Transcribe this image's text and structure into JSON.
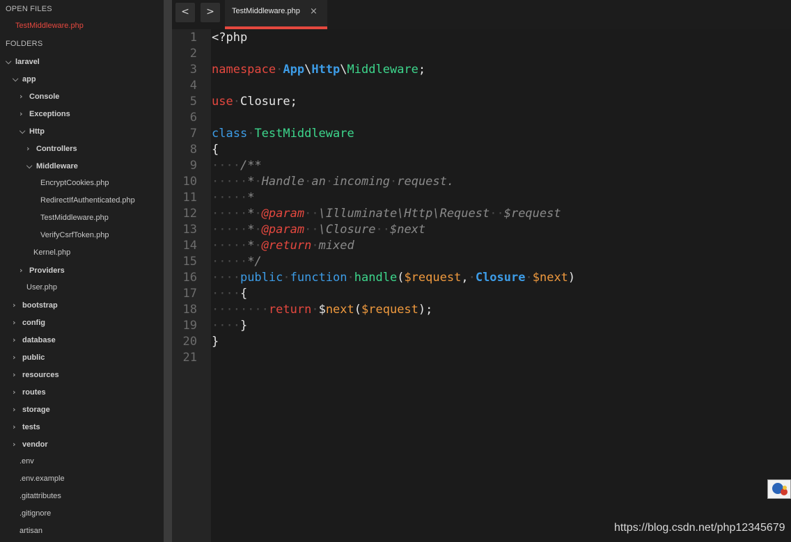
{
  "sidebar": {
    "open_files_title": "OPEN FILES",
    "open_file": "TestMiddleware.php",
    "folders_title": "FOLDERS",
    "tree": [
      {
        "label": "laravel",
        "type": "folder",
        "expanded": true,
        "depth": 0
      },
      {
        "label": "app",
        "type": "folder",
        "expanded": true,
        "depth": 1
      },
      {
        "label": "Console",
        "type": "folder",
        "expanded": false,
        "depth": 2
      },
      {
        "label": "Exceptions",
        "type": "folder",
        "expanded": false,
        "depth": 2
      },
      {
        "label": "Http",
        "type": "folder",
        "expanded": true,
        "depth": 2
      },
      {
        "label": "Controllers",
        "type": "folder",
        "expanded": false,
        "depth": 3
      },
      {
        "label": "Middleware",
        "type": "folder",
        "expanded": true,
        "depth": 3
      },
      {
        "label": "EncryptCookies.php",
        "type": "file",
        "depth": 4
      },
      {
        "label": "RedirectIfAuthenticated.php",
        "type": "file",
        "depth": 4
      },
      {
        "label": "TestMiddleware.php",
        "type": "file",
        "depth": 4,
        "active": true
      },
      {
        "label": "VerifyCsrfToken.php",
        "type": "file",
        "depth": 4
      },
      {
        "label": "Kernel.php",
        "type": "file",
        "depth": 3
      },
      {
        "label": "Providers",
        "type": "folder",
        "expanded": false,
        "depth": 2
      },
      {
        "label": "User.php",
        "type": "file",
        "depth": 2
      },
      {
        "label": "bootstrap",
        "type": "folder",
        "expanded": false,
        "depth": 1
      },
      {
        "label": "config",
        "type": "folder",
        "expanded": false,
        "depth": 1
      },
      {
        "label": "database",
        "type": "folder",
        "expanded": false,
        "depth": 1
      },
      {
        "label": "public",
        "type": "folder",
        "expanded": false,
        "depth": 1
      },
      {
        "label": "resources",
        "type": "folder",
        "expanded": false,
        "depth": 1
      },
      {
        "label": "routes",
        "type": "folder",
        "expanded": false,
        "depth": 1
      },
      {
        "label": "storage",
        "type": "folder",
        "expanded": false,
        "depth": 1
      },
      {
        "label": "tests",
        "type": "folder",
        "expanded": false,
        "depth": 1
      },
      {
        "label": "vendor",
        "type": "folder",
        "expanded": false,
        "depth": 1
      },
      {
        "label": ".env",
        "type": "file",
        "depth": 1
      },
      {
        "label": ".env.example",
        "type": "file",
        "depth": 1
      },
      {
        "label": ".gitattributes",
        "type": "file",
        "depth": 1
      },
      {
        "label": ".gitignore",
        "type": "file",
        "depth": 1
      },
      {
        "label": "artisan",
        "type": "file",
        "depth": 1
      }
    ]
  },
  "tabs": {
    "back_glyph": "<",
    "forward_glyph": ">",
    "active_tab": "TestMiddleware.php",
    "close_glyph": "×"
  },
  "editor": {
    "lines": [
      [
        [
          "t",
          "<?php"
        ]
      ],
      [],
      [
        [
          "k",
          "namespace"
        ],
        [
          "w",
          "·"
        ],
        [
          "n",
          "App"
        ],
        [
          "t",
          "\\"
        ],
        [
          "n",
          "Http"
        ],
        [
          "t",
          "\\"
        ],
        [
          "c",
          "Middleware"
        ],
        [
          "t",
          ";"
        ]
      ],
      [],
      [
        [
          "k",
          "use"
        ],
        [
          "w",
          "·"
        ],
        [
          "t",
          "Closure;"
        ]
      ],
      [],
      [
        [
          "b",
          "class"
        ],
        [
          "w",
          "·"
        ],
        [
          "c",
          "TestMiddleware"
        ]
      ],
      [
        [
          "t",
          "{"
        ]
      ],
      [
        [
          "w",
          "····"
        ],
        [
          "m",
          "/**"
        ]
      ],
      [
        [
          "w",
          "·····"
        ],
        [
          "m",
          "*"
        ],
        [
          "w",
          "·"
        ],
        [
          "m",
          "Handle"
        ],
        [
          "w",
          "·"
        ],
        [
          "m",
          "an"
        ],
        [
          "w",
          "·"
        ],
        [
          "m",
          "incoming"
        ],
        [
          "w",
          "·"
        ],
        [
          "m",
          "request."
        ]
      ],
      [
        [
          "w",
          "·····"
        ],
        [
          "m",
          "*"
        ]
      ],
      [
        [
          "w",
          "·····"
        ],
        [
          "m",
          "*"
        ],
        [
          "w",
          "·"
        ],
        [
          "g",
          "@param"
        ],
        [
          "w",
          "··"
        ],
        [
          "m",
          "\\Illuminate\\Http\\Request"
        ],
        [
          "w",
          "··"
        ],
        [
          "m",
          "$request"
        ]
      ],
      [
        [
          "w",
          "·····"
        ],
        [
          "m",
          "*"
        ],
        [
          "w",
          "·"
        ],
        [
          "g",
          "@param"
        ],
        [
          "w",
          "··"
        ],
        [
          "m",
          "\\Closure"
        ],
        [
          "w",
          "··"
        ],
        [
          "m",
          "$next"
        ]
      ],
      [
        [
          "w",
          "·····"
        ],
        [
          "m",
          "*"
        ],
        [
          "w",
          "·"
        ],
        [
          "g",
          "@return"
        ],
        [
          "w",
          "·"
        ],
        [
          "m",
          "mixed"
        ]
      ],
      [
        [
          "w",
          "·····"
        ],
        [
          "m",
          "*/"
        ]
      ],
      [
        [
          "w",
          "····"
        ],
        [
          "b",
          "public"
        ],
        [
          "w",
          "·"
        ],
        [
          "b",
          "function"
        ],
        [
          "w",
          "·"
        ],
        [
          "f",
          "handle"
        ],
        [
          "t",
          "("
        ],
        [
          "v",
          "$request"
        ],
        [
          "t",
          ","
        ],
        [
          "w",
          "·"
        ],
        [
          "n",
          "Closure"
        ],
        [
          "w",
          "·"
        ],
        [
          "v",
          "$next"
        ],
        [
          "t",
          ")"
        ]
      ],
      [
        [
          "w",
          "····"
        ],
        [
          "t",
          "{"
        ]
      ],
      [
        [
          "w",
          "········"
        ],
        [
          "k",
          "return"
        ],
        [
          "w",
          "·"
        ],
        [
          "t",
          "$"
        ],
        [
          "v",
          "next"
        ],
        [
          "t",
          "("
        ],
        [
          "v",
          "$request"
        ],
        [
          "t",
          ");"
        ]
      ],
      [
        [
          "w",
          "····"
        ],
        [
          "t",
          "}"
        ]
      ],
      [
        [
          "t",
          "}"
        ]
      ],
      []
    ],
    "colors": {
      "keyword": "#e5483f",
      "namespace": "#3d9ce6",
      "class": "#3dd68c",
      "comment": "#8a8a8a",
      "variable": "#f09a3e",
      "accent": "#e5483f"
    }
  },
  "watermark": "https://blog.csdn.net/php12345679"
}
